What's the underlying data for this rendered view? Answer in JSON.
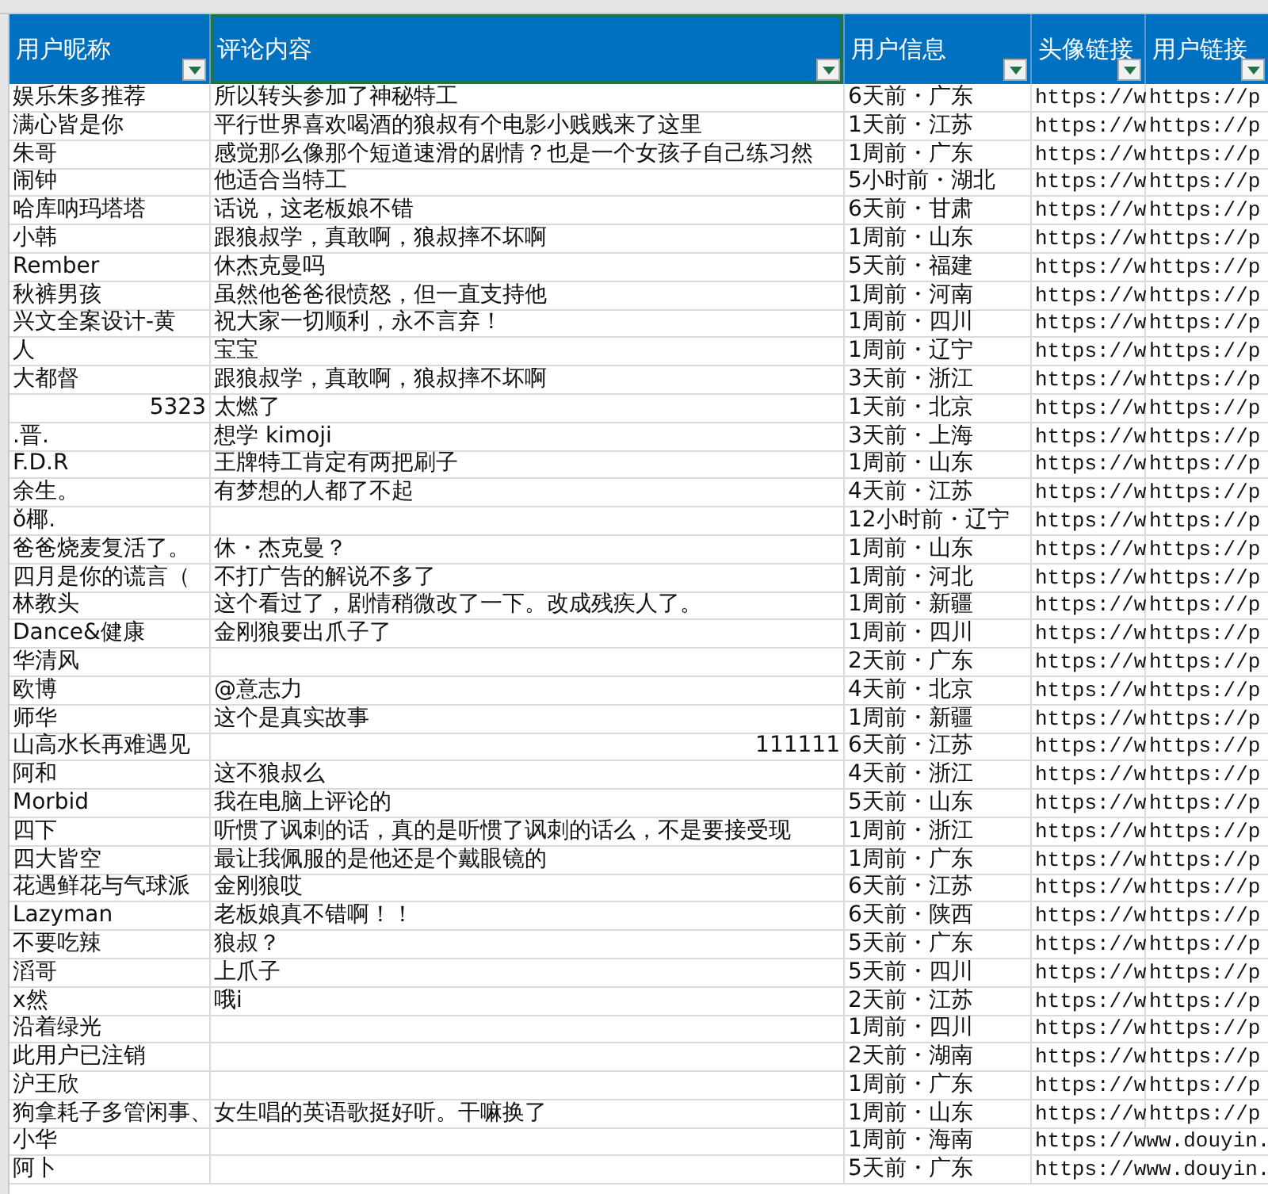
{
  "columns": [
    {
      "label": "用户昵称",
      "selected": false,
      "filter": true
    },
    {
      "label": "评论内容",
      "selected": true,
      "filter": true
    },
    {
      "label": "用户信息",
      "selected": false,
      "filter": true
    },
    {
      "label": "头像链接",
      "selected": false,
      "filter": true
    },
    {
      "label": "用户链接",
      "selected": false,
      "filter": true
    }
  ],
  "rows": [
    {
      "kind": "text",
      "nickname": "娱乐朱多推荐",
      "comment": "所以转头参加了神秘特工",
      "user_info": "6天前・广东",
      "avatar_link": "https://w",
      "user_link": "https://p"
    },
    {
      "kind": "text",
      "nickname": "满心皆是你",
      "comment": "平行世界喜欢喝酒的狼叔有个电影小贱贱来了这里",
      "user_info": "1天前・江苏",
      "avatar_link": "https://w",
      "user_link": "https://p"
    },
    {
      "kind": "text",
      "nickname": "朱哥",
      "comment": "感觉那么像那个短道速滑的剧情？也是一个女孩子自己练习然",
      "user_info": "1周前・广东",
      "avatar_link": "https://w",
      "user_link": "https://p"
    },
    {
      "kind": "text",
      "nickname": "闹钟",
      "comment": "他适合当特工",
      "user_info": "5小时前・湖北",
      "avatar_link": "https://w",
      "user_link": "https://p"
    },
    {
      "kind": "text",
      "nickname": "哈库呐玛塔塔",
      "comment": "话说，这老板娘不错",
      "user_info": "6天前・甘肃",
      "avatar_link": "https://w",
      "user_link": "https://p"
    },
    {
      "kind": "text",
      "nickname": "小韩",
      "comment": "跟狼叔学，真敢啊，狼叔摔不坏啊",
      "user_info": "1周前・山东",
      "avatar_link": "https://w",
      "user_link": "https://p"
    },
    {
      "kind": "text",
      "nickname": "Rember",
      "comment": "休杰克曼吗",
      "user_info": "5天前・福建",
      "avatar_link": "https://w",
      "user_link": "https://p"
    },
    {
      "kind": "text",
      "nickname": "秋裤男孩",
      "comment": "虽然他爸爸很愤怒，但一直支持他",
      "user_info": "1周前・河南",
      "avatar_link": "https://w",
      "user_link": "https://p"
    },
    {
      "kind": "text",
      "nickname": "兴文全案设计-黄",
      "comment": "祝大家一切顺利，永不言弃！",
      "user_info": "1周前・四川",
      "avatar_link": "https://w",
      "user_link": "https://p"
    },
    {
      "kind": "text",
      "nickname": "人",
      "comment": "宝宝",
      "user_info": "1周前・辽宁",
      "avatar_link": "https://w",
      "user_link": "https://p"
    },
    {
      "kind": "text",
      "nickname": "大都督",
      "comment": "跟狼叔学，真敢啊，狼叔摔不坏啊",
      "user_info": "3天前・浙江",
      "avatar_link": "https://w",
      "user_link": "https://p"
    },
    {
      "kind": "number-nickname",
      "nickname": "5323",
      "comment": "太燃了",
      "user_info": "1天前・北京",
      "avatar_link": "https://w",
      "user_link": "https://p"
    },
    {
      "kind": "text",
      "nickname": ".晋.",
      "comment": "想学 kimoji",
      "user_info": "3天前・上海",
      "avatar_link": "https://w",
      "user_link": "https://p"
    },
    {
      "kind": "text",
      "nickname": "F.D.R",
      "comment": "王牌特工肯定有两把刷子",
      "user_info": "1周前・山东",
      "avatar_link": "https://w",
      "user_link": "https://p"
    },
    {
      "kind": "text",
      "nickname": "余生。",
      "comment": "有梦想的人都了不起",
      "user_info": "4天前・江苏",
      "avatar_link": "https://w",
      "user_link": "https://p"
    },
    {
      "kind": "text",
      "nickname": "ǒ椰.",
      "user_info": "12小时前・辽宁",
      "avatar_link": "https://w",
      "user_link": "https://p"
    },
    {
      "kind": "text",
      "nickname": "爸爸烧麦复活了。",
      "comment": "休・杰克曼？",
      "user_info": "1周前・山东",
      "avatar_link": "https://w",
      "user_link": "https://p"
    },
    {
      "kind": "text",
      "nickname": "四月是你的谎言（",
      "comment": "不打广告的解说不多了",
      "user_info": "1周前・河北",
      "avatar_link": "https://w",
      "user_link": "https://p"
    },
    {
      "kind": "text",
      "nickname": "林教头",
      "comment": "这个看过了，剧情稍微改了一下。改成残疾人了。",
      "user_info": "1周前・新疆",
      "avatar_link": "https://w",
      "user_link": "https://p"
    },
    {
      "kind": "text",
      "nickname": "Dance&健康",
      "comment": "金刚狼要出爪子了",
      "user_info": "1周前・四川",
      "avatar_link": "https://w",
      "user_link": "https://p"
    },
    {
      "kind": "text",
      "nickname": "华清风",
      "user_info": "2天前・广东",
      "avatar_link": "https://w",
      "user_link": "https://p"
    },
    {
      "kind": "text",
      "nickname": "欧博",
      "comment": "@意志力",
      "user_info": "4天前・北京",
      "avatar_link": "https://w",
      "user_link": "https://p"
    },
    {
      "kind": "text",
      "nickname": "师华",
      "comment": "这个是真实故事",
      "user_info": "1周前・新疆",
      "avatar_link": "https://w",
      "user_link": "https://p"
    },
    {
      "kind": "number-comment",
      "nickname": "山高水长再难遇见",
      "comment": "111111",
      "user_info": "6天前・江苏",
      "avatar_link": "https://w",
      "user_link": "https://p"
    },
    {
      "kind": "text",
      "nickname": "阿和",
      "comment": "这不狼叔么",
      "user_info": "4天前・浙江",
      "avatar_link": "https://w",
      "user_link": "https://p"
    },
    {
      "kind": "text",
      "nickname": "Morbid",
      "comment": "我在电脑上评论的",
      "user_info": "5天前・山东",
      "avatar_link": "https://w",
      "user_link": "https://p"
    },
    {
      "kind": "text",
      "nickname": "四下",
      "comment": "听惯了讽刺的话，真的是听惯了讽刺的话么，不是要接受现",
      "user_info": "1周前・浙江",
      "avatar_link": "https://w",
      "user_link": "https://p"
    },
    {
      "kind": "text",
      "nickname": "四大皆空",
      "comment": "最让我佩服的是他还是个戴眼镜的",
      "user_info": "1周前・广东",
      "avatar_link": "https://w",
      "user_link": "https://p"
    },
    {
      "kind": "text",
      "nickname": "花遇鲜花与气球派",
      "comment": "金刚狼哎",
      "user_info": "6天前・江苏",
      "avatar_link": "https://w",
      "user_link": "https://p"
    },
    {
      "kind": "text",
      "nickname": "Lazyman",
      "comment": "老板娘真不错啊！！",
      "user_info": "6天前・陕西",
      "avatar_link": "https://w",
      "user_link": "https://p"
    },
    {
      "kind": "text",
      "nickname": "不要吃辣",
      "comment": "狼叔？",
      "user_info": "5天前・广东",
      "avatar_link": "https://w",
      "user_link": "https://p"
    },
    {
      "kind": "text",
      "nickname": "滔哥",
      "comment": "上爪子",
      "user_info": "5天前・四川",
      "avatar_link": "https://w",
      "user_link": "https://p"
    },
    {
      "kind": "text",
      "nickname": "x然",
      "comment": "哦i",
      "user_info": "2天前・江苏",
      "avatar_link": "https://w",
      "user_link": "https://p"
    },
    {
      "kind": "text",
      "nickname": "沿着绿光",
      "user_info": "1周前・四川",
      "avatar_link": "https://w",
      "user_link": "https://p"
    },
    {
      "kind": "text",
      "nickname": "此用户已注销",
      "user_info": "2天前・湖南",
      "avatar_link": "https://w",
      "user_link": "https://p"
    },
    {
      "kind": "text",
      "nickname": "沪王欣",
      "user_info": "1周前・广东",
      "avatar_link": "https://w",
      "user_link": "https://p"
    },
    {
      "kind": "text",
      "nickname": "狗拿耗子多管闲事、",
      "comment": "女生唱的英语歌挺好听。干嘛换了",
      "user_info": "1周前・山东",
      "avatar_link": "https://w",
      "user_link": "https://p"
    },
    {
      "kind": "text",
      "nickname": "小华",
      "user_info": "1周前・海南",
      "avatar_link": "https://www.douyin."
    },
    {
      "kind": "text",
      "nickname": "阿卜",
      "user_info": "5天前・广东",
      "avatar_link": "https://www.douyin."
    }
  ]
}
